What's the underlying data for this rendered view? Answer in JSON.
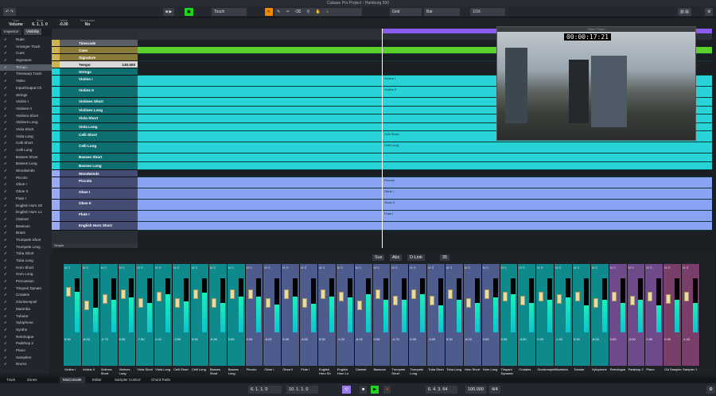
{
  "window": {
    "title": "Cubase Pro Project - Hamburg 500"
  },
  "toolbar": {
    "automation_mode": "Touch",
    "snap_type": "Grid",
    "grid": "Bar",
    "quantize": "1/16"
  },
  "infoline": [
    {
      "label": "Type",
      "value": "Volume"
    },
    {
      "label": "Start",
      "value": "6. 1. 1. 0"
    },
    {
      "label": "Value",
      "value": "-0.00"
    },
    {
      "label": "Terminator",
      "value": "No"
    }
  ],
  "left_tabs": [
    "Inspector",
    "Visibility"
  ],
  "visibility": [
    "Ruler",
    "Arranger Track",
    "Cues",
    "Signature",
    "Tempo",
    "Timewarp Track",
    "Video",
    "Input/Output Ch",
    "Strings",
    "Violins I",
    "Violines II",
    "Violines Short",
    "Violines Long",
    "Viola Short",
    "Viola Long",
    "Celli Short",
    "Celli Long",
    "Basses Short",
    "Basses Long",
    "Woodwinds",
    "Piccolo",
    "Oboe I",
    "Oboe II",
    "Flute I",
    "English Horn Sh",
    "English Horn Lo",
    "Clarinet",
    "Bassoon",
    "Brass",
    "Trumpets Short",
    "Trumpets Long",
    "Tuba Short",
    "Tuba Long",
    "Horn Short",
    "Horn Long",
    "Percussion",
    "Timpani Dynam",
    "Crotales",
    "Glockenspiel",
    "Marimba",
    "Tubular",
    "Xylophone",
    "Synths",
    "Retrologue",
    "Padshop 2",
    "Piano",
    "Samplers",
    "Drums"
  ],
  "tracks": [
    {
      "name": "Timecode",
      "type": "ruler"
    },
    {
      "name": "Cues",
      "type": "marker"
    },
    {
      "name": "Signature",
      "type": "marker"
    },
    {
      "name": "Tempo",
      "type": "tempo",
      "value": "130.000"
    },
    {
      "name": "Strings",
      "type": "folder",
      "group": "strings"
    },
    {
      "name": "Violins I",
      "group": "strings",
      "event": "Violins I"
    },
    {
      "name": "Violins II",
      "group": "strings",
      "event": "Violins II"
    },
    {
      "name": "Violines Short",
      "group": "strings"
    },
    {
      "name": "Violines Long",
      "group": "strings"
    },
    {
      "name": "Viola Short",
      "group": "strings"
    },
    {
      "name": "Viola Long",
      "group": "strings"
    },
    {
      "name": "Celli Short",
      "group": "strings",
      "event": "Celli Short"
    },
    {
      "name": "Celli Long",
      "group": "strings",
      "event": "Celli Long"
    },
    {
      "name": "Basses Short",
      "group": "strings"
    },
    {
      "name": "Basses Long",
      "group": "strings"
    },
    {
      "name": "Woodwinds",
      "type": "folder",
      "group": "woodwinds"
    },
    {
      "name": "Piccolo",
      "group": "woodwinds",
      "event": "Piccolo"
    },
    {
      "name": "Oboe I",
      "group": "woodwinds",
      "event": "Oboe I"
    },
    {
      "name": "Oboe II",
      "group": "woodwinds",
      "event": "Oboe II"
    },
    {
      "name": "Flute I",
      "group": "woodwinds",
      "event": "Flute I"
    },
    {
      "name": "English Horn Short",
      "group": "woodwinds"
    }
  ],
  "arranger_label": "Simple",
  "video": {
    "title": "Video Player",
    "timecode": "00:00:17:21"
  },
  "mixer": {
    "buttons": [
      "Sus",
      "Abc",
      "D-Link"
    ],
    "value": "35",
    "channels": [
      {
        "n": "Violins I",
        "g": "strings",
        "v": "0.00",
        "m": 0.75,
        "f": 0.2
      },
      {
        "n": "Violins II",
        "g": "strings",
        "v": "-6.02",
        "m": 0.45,
        "f": 0.5
      },
      {
        "n": "Violines Short",
        "g": "strings",
        "v": "-3.73",
        "m": 0.6,
        "f": 0.35
      },
      {
        "n": "Violines Long",
        "g": "strings",
        "v": "0.00",
        "m": 0.65,
        "f": 0.25
      },
      {
        "n": "Viola Short",
        "g": "strings",
        "v": "-7.50",
        "m": 0.55,
        "f": 0.45
      },
      {
        "n": "Viola Long",
        "g": "strings",
        "v": "0.41",
        "m": 0.7,
        "f": 0.3
      },
      {
        "n": "Celli Short",
        "g": "strings",
        "v": "-3.50",
        "m": 0.58,
        "f": 0.45
      },
      {
        "n": "Celli Long",
        "g": "strings",
        "v": "0.00",
        "m": 0.73,
        "f": 0.25
      },
      {
        "n": "Basses Short",
        "g": "strings",
        "v": "-6.66",
        "m": 0.55,
        "f": 0.45
      },
      {
        "n": "Basses Long",
        "g": "strings",
        "v": "0.00",
        "m": 0.66,
        "f": 0.25
      },
      {
        "n": "Piccolo",
        "g": "woodwinds",
        "v": "0.00",
        "m": 0.66,
        "f": 0.25
      },
      {
        "n": "Oboe I",
        "g": "woodwinds",
        "v": "-6.02",
        "m": 0.52,
        "f": 0.45
      },
      {
        "n": "Oboe II",
        "g": "woodwinds",
        "v": "0.00",
        "m": 0.66,
        "f": 0.25
      },
      {
        "n": "Flute I",
        "g": "woodwinds",
        "v": "-6.02",
        "m": 0.53,
        "f": 0.45
      },
      {
        "n": "English Horn Sh",
        "g": "woodwinds",
        "v": "0.00",
        "m": 0.66,
        "f": 0.25
      },
      {
        "n": "English Horn Lo",
        "g": "woodwinds",
        "v": "-1.02",
        "m": 0.64,
        "f": 0.3
      },
      {
        "n": "Clarinet",
        "g": "woodwinds",
        "v": "-6.02",
        "m": 0.7,
        "f": 0.5
      },
      {
        "n": "Bassoon",
        "g": "woodwinds",
        "v": "0.00",
        "m": 0.6,
        "f": 0.25
      },
      {
        "n": "Trumpets Short",
        "g": "brass",
        "v": "-4.73",
        "m": 0.6,
        "f": 0.4
      },
      {
        "n": "Trumpets Long",
        "g": "brass",
        "v": "0.00",
        "m": 0.7,
        "f": 0.25
      },
      {
        "n": "Tuba Short",
        "g": "brass",
        "v": "-3.00",
        "m": 0.5,
        "f": 0.4
      },
      {
        "n": "Tuba Long",
        "g": "brass",
        "v": "0.00",
        "m": 0.6,
        "f": 0.25
      },
      {
        "n": "Horn Short",
        "g": "brass",
        "v": "-6.02",
        "m": 0.55,
        "f": 0.45
      },
      {
        "n": "Horn Long",
        "g": "brass",
        "v": "0.00",
        "m": 0.65,
        "f": 0.25
      },
      {
        "n": "Timpani Dynamic",
        "g": "perc",
        "v": "0.00",
        "m": 0.7,
        "f": 0.3
      },
      {
        "n": "Crotales",
        "g": "perc",
        "v": "-3.00",
        "m": 0.55,
        "f": 0.4
      },
      {
        "n": "Glockenspiel",
        "g": "perc",
        "v": "0.00",
        "m": 0.6,
        "f": 0.3
      },
      {
        "n": "Marimba",
        "g": "perc",
        "v": "-1.02",
        "m": 0.65,
        "f": 0.35
      },
      {
        "n": "Tubular",
        "g": "perc",
        "v": "0.00",
        "m": 0.5,
        "f": 0.3
      },
      {
        "n": "Xylophone",
        "g": "perc",
        "v": "-6.02",
        "m": 0.6,
        "f": 0.45
      },
      {
        "n": "Retrologue",
        "g": "synths",
        "v": "0.00",
        "m": 0.55,
        "f": 0.3
      },
      {
        "n": "Padshop 2",
        "g": "synths",
        "v": "-3.00",
        "m": 0.6,
        "f": 0.4
      },
      {
        "n": "Piano",
        "g": "synths",
        "v": "0.00",
        "m": 0.5,
        "f": 0.3
      },
      {
        "n": "GA Sampler",
        "g": "samplers",
        "v": "0.00",
        "m": 0.6,
        "f": 0.35
      },
      {
        "n": "Sampler 1",
        "g": "samplers",
        "v": "-1.02",
        "m": 0.55,
        "f": 0.3
      }
    ]
  },
  "group_colors": {
    "strings": "#0f8a8c",
    "woodwinds": "#4d5c8c",
    "brass": "#4d5c8c",
    "perc": "#0f8a8c",
    "synths": "#6e4a8a",
    "samplers": "#7a3e6a"
  },
  "lane_colors": {
    "strings": "#27d3d6",
    "woodwinds": "#8aa2f2"
  },
  "bottom_tabs": [
    "Track",
    "Zones",
    "MixConsole",
    "Editor",
    "Sampler Control",
    "Chord Pads"
  ],
  "transport": {
    "left_locator": "6. 1. 1. 0",
    "right_locator": "10. 1. 1. 0",
    "position": "6. 4. 3. 64",
    "tempo": "100.000",
    "signature": "4/4"
  }
}
